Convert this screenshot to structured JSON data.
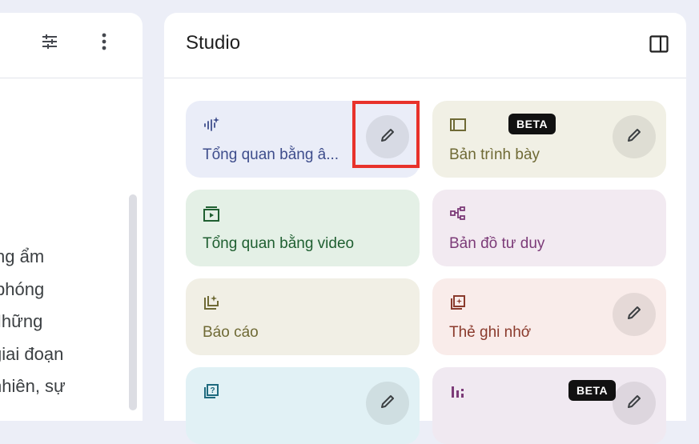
{
  "left_panel": {
    "toolbar": [
      {
        "name": "tune-icon"
      },
      {
        "name": "more-vert-icon"
      }
    ],
    "text_lines": [
      "ng ẩm",
      "phóng",
      "Những",
      "giai đoạn",
      "nhiên, sự"
    ]
  },
  "studio": {
    "title": "Studio",
    "toggle_icon": "dock-panel-icon",
    "cards": [
      {
        "label": "Tổng quan bằng â...",
        "icon": "audio-sparkle-icon",
        "bg": "#eaedf8",
        "color": "#3e4d8c",
        "edit": true,
        "beta": false
      },
      {
        "label": "Bản trình bày",
        "icon": "slides-icon",
        "bg": "#f1f0e5",
        "color": "#6f6a35",
        "edit": true,
        "beta": true,
        "beta_label": "BETA"
      },
      {
        "label": "Tổng quan bằng video",
        "icon": "video-icon",
        "bg": "#e4f0e6",
        "color": "#1f5f31",
        "edit": false,
        "beta": false
      },
      {
        "label": "Bản đồ tư duy",
        "icon": "mind-map-icon",
        "bg": "#f2eaf1",
        "color": "#7c3b78",
        "edit": false,
        "beta": false
      },
      {
        "label": "Báo cáo",
        "icon": "report-icon",
        "bg": "#f1efe5",
        "color": "#6f6a35",
        "edit": false,
        "beta": false
      },
      {
        "label": "Thẻ ghi nhớ",
        "icon": "flashcard-icon",
        "bg": "#f9ecea",
        "color": "#8a3a2c",
        "edit": true,
        "beta": false
      },
      {
        "label": "",
        "icon": "quiz-icon",
        "bg": "#e1f1f5",
        "color": "#1e6a7e",
        "edit": true,
        "beta": false
      },
      {
        "label": "",
        "icon": "infographic-icon",
        "bg": "#f0e9f1",
        "color": "#7c3b78",
        "edit": true,
        "beta": true,
        "beta_label": "BETA"
      }
    ]
  },
  "highlight": {
    "color": "#e8322b",
    "target": "edit-button-audio-overview"
  }
}
